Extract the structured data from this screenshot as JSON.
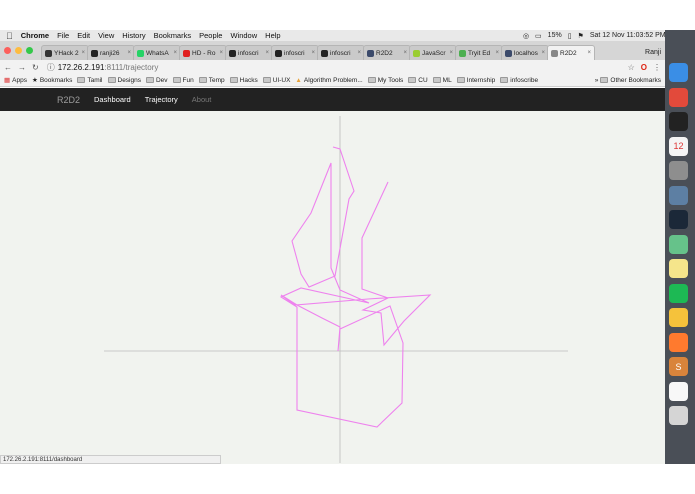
{
  "os_menubar": {
    "app": "Chrome",
    "menus": [
      "File",
      "Edit",
      "View",
      "History",
      "Bookmarks",
      "People",
      "Window",
      "Help"
    ],
    "battery": "15%",
    "clock": "Sat 12 Nov  11:03:52 PM"
  },
  "tabs": [
    {
      "label": "YHack 2",
      "color": "#333333"
    },
    {
      "label": "ranji26",
      "color": "#222222"
    },
    {
      "label": "WhatsA",
      "color": "#25d366"
    },
    {
      "label": "HD - Ro",
      "color": "#e02020"
    },
    {
      "label": "infoscri",
      "color": "#222222"
    },
    {
      "label": "infoscri",
      "color": "#222222"
    },
    {
      "label": "infoscri",
      "color": "#222222"
    },
    {
      "label": "R2D2",
      "color": "#3b4a6b"
    },
    {
      "label": "JavaScr",
      "color": "#9acd32"
    },
    {
      "label": "Tryit Ed",
      "color": "#4caf50"
    },
    {
      "label": "localhos",
      "color": "#3b4a6b"
    },
    {
      "label": "R2D2",
      "color": "#888888",
      "active": true
    }
  ],
  "profile_name": "Ranji",
  "address": {
    "host": "172.26.2.191",
    "path": ":8111/trajectory"
  },
  "bookmarks": {
    "apps": "Apps",
    "items": [
      "Bookmarks",
      "Tamil",
      "Designs",
      "Dev",
      "Fun",
      "Temp",
      "Hacks",
      "UI-UX",
      "Algorithm Problem...",
      "My Tools",
      "CU",
      "ML",
      "Internship",
      "infoscribe"
    ],
    "other": "Other Bookmarks"
  },
  "navbar": {
    "brand": "R2D2",
    "links": [
      "Dashboard",
      "Trajectory",
      "About"
    ]
  },
  "trajectory": {
    "line_color": "#ee82ee",
    "axis_color": "#bbbbbb",
    "points": [
      [
        -7,
        -204
      ],
      [
        0,
        -202
      ],
      [
        14,
        -160
      ],
      [
        9,
        -152
      ],
      [
        -5,
        -75
      ],
      [
        -31,
        -64
      ],
      [
        -39,
        -77
      ],
      [
        -48,
        -110
      ],
      [
        -29,
        -138
      ],
      [
        -9,
        -188
      ],
      [
        -9,
        -83
      ],
      [
        0,
        -61
      ],
      [
        29,
        -48
      ],
      [
        -39,
        -63
      ],
      [
        -59,
        -54
      ],
      [
        -43,
        -44
      ],
      [
        -43,
        59
      ],
      [
        37,
        76
      ],
      [
        62,
        52
      ],
      [
        63,
        -8
      ],
      [
        50,
        -45
      ],
      [
        0,
        -22
      ],
      [
        -2,
        0
      ],
      [
        0,
        -24
      ],
      [
        -18,
        -33
      ],
      [
        -43,
        -46
      ],
      [
        -59,
        -56
      ],
      [
        -45,
        -46
      ],
      [
        28,
        -52
      ],
      [
        90,
        -56
      ],
      [
        64,
        -30
      ],
      [
        44,
        -6
      ],
      [
        41,
        -38
      ],
      [
        23,
        -41
      ],
      [
        48,
        -53
      ],
      [
        22,
        -62
      ],
      [
        22,
        -113
      ],
      [
        48,
        -169
      ]
    ]
  },
  "status_url": "172.26.2.191:8111/dashboard",
  "dock": [
    {
      "name": "finder-icon",
      "color": "#3a8ee6"
    },
    {
      "name": "chrome-icon",
      "color": "#e24a3b"
    },
    {
      "name": "terminal-icon",
      "color": "#222222"
    },
    {
      "name": "calendar-icon",
      "color": "#f4f4f4",
      "text": "12"
    },
    {
      "name": "system-preferences-icon",
      "color": "#8e8e8e"
    },
    {
      "name": "hardware-icon",
      "color": "#5d7fa3"
    },
    {
      "name": "steam-icon",
      "color": "#1b2838"
    },
    {
      "name": "atom-icon",
      "color": "#66c28a"
    },
    {
      "name": "notes-icon",
      "color": "#f5e58b"
    },
    {
      "name": "spotify-icon",
      "color": "#1db954"
    },
    {
      "name": "tips-icon",
      "color": "#f5c23b"
    },
    {
      "name": "sublime-icon",
      "color": "#ff7a2e"
    },
    {
      "name": "s-app-icon",
      "color": "#d9843b",
      "text": "S"
    },
    {
      "name": "document-icon",
      "color": "#f8f8f8"
    },
    {
      "name": "trash-icon",
      "color": "#d5d5d5"
    }
  ]
}
